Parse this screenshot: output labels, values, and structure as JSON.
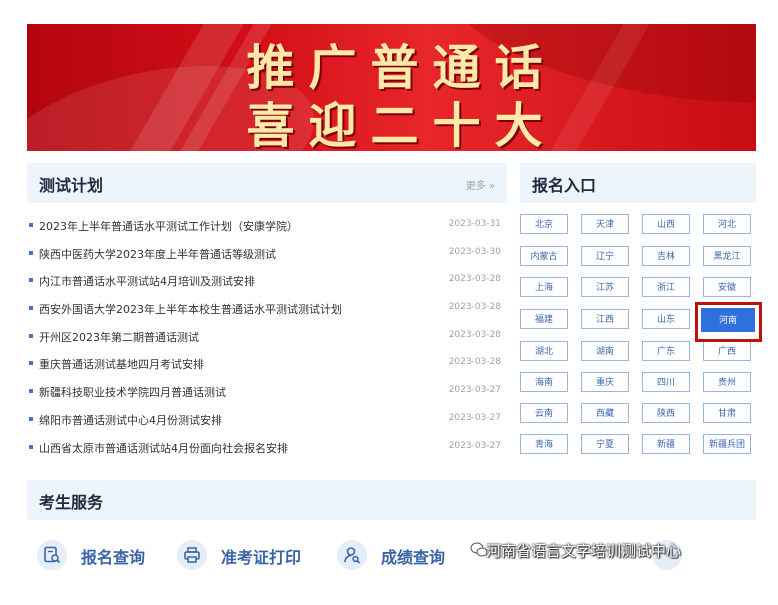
{
  "banner": {
    "line1": "推广普通话",
    "line2": "喜迎二十大"
  },
  "plan": {
    "title": "测试计划",
    "more": "更多 »",
    "items": [
      {
        "text": "2023年上半年普通话水平测试工作计划（安康学院）",
        "date": "2023-03-31"
      },
      {
        "text": "陕西中医药大学2023年度上半年普通话等级测试",
        "date": "2023-03-30"
      },
      {
        "text": "内江市普通话水平测试站4月培训及测试安排",
        "date": "2023-03-28"
      },
      {
        "text": "西安外国语大学2023年上半年本校生普通话水平测试测试计划",
        "date": "2023-03-28"
      },
      {
        "text": "开州区2023年第二期普通话测试",
        "date": "2023-03-28"
      },
      {
        "text": "重庆普通话测试基地四月考试安排",
        "date": "2023-03-28"
      },
      {
        "text": "新疆科技职业技术学院四月普通话测试",
        "date": "2023-03-27"
      },
      {
        "text": "绵阳市普通话测试中心4月份测试安排",
        "date": "2023-03-27"
      },
      {
        "text": "山西省太原市普通话测试站4月份面向社会报名安排",
        "date": "2023-03-27"
      }
    ]
  },
  "registration": {
    "title": "报名入口",
    "provinces": [
      "北京",
      "天津",
      "山西",
      "河北",
      "内蒙古",
      "辽宁",
      "吉林",
      "黑龙江",
      "上海",
      "江苏",
      "浙江",
      "安徽",
      "福建",
      "江西",
      "山东",
      "河南",
      "湖北",
      "湖南",
      "广东",
      "广西",
      "海南",
      "重庆",
      "四川",
      "贵州",
      "云南",
      "西藏",
      "陕西",
      "甘肃",
      "青海",
      "宁夏",
      "新疆",
      "新疆兵团"
    ],
    "selected": "河南"
  },
  "services": {
    "title": "考生服务",
    "items": [
      {
        "label": "报名查询",
        "icon": "search-doc-icon"
      },
      {
        "label": "准考证打印",
        "icon": "printer-icon"
      },
      {
        "label": "成绩查询",
        "icon": "user-search-icon"
      }
    ]
  },
  "watermark": "河南省语言文字培训测试中心",
  "colors": {
    "accent": "#2f6fde",
    "banner_red": "#d20e16",
    "highlight": "#c01010",
    "head_bg": "#edf4fb"
  }
}
